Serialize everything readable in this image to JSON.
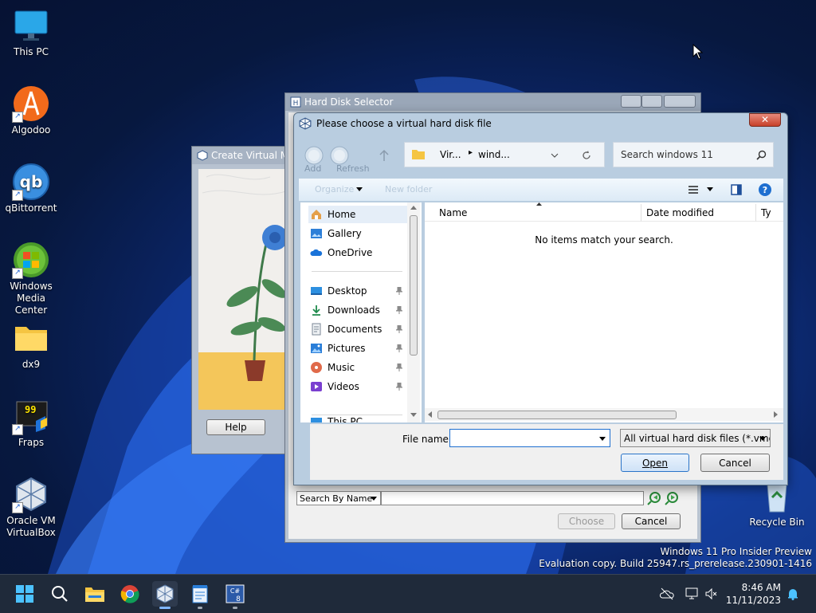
{
  "desktop": {
    "icons": [
      {
        "label": "This PC"
      },
      {
        "label": "Algodoo"
      },
      {
        "label": "qBittorrent"
      },
      {
        "label": "Windows Media Center"
      },
      {
        "label": "dx9"
      },
      {
        "label": "Fraps"
      },
      {
        "label": "Oracle VM VirtualBox"
      },
      {
        "label": "Recycle Bin"
      }
    ],
    "watermark_line1": "Windows 11 Pro Insider Preview",
    "watermark_line2": "Evaluation copy. Build 25947.rs_prerelease.230901-1416"
  },
  "create_vm": {
    "title": "Create Virtual M",
    "help_label": "Help"
  },
  "hd_selector": {
    "title": "Hard Disk Selector",
    "search_mode": "Search By Name",
    "choose_label": "Choose",
    "cancel_label": "Cancel"
  },
  "file_dialog": {
    "title": "Please choose a virtual hard disk file",
    "toolbar_add": "Add",
    "toolbar_refresh": "Refresh",
    "breadcrumb": [
      "Vir...",
      "wind..."
    ],
    "search_placeholder": "Search windows 11",
    "organize_label": "Organize",
    "new_folder_label": "New folder",
    "nav": {
      "home": "Home",
      "gallery": "Gallery",
      "onedrive": "OneDrive",
      "desktop": "Desktop",
      "downloads": "Downloads",
      "documents": "Documents",
      "pictures": "Pictures",
      "music": "Music",
      "videos": "Videos",
      "this_pc": "This PC"
    },
    "columns": {
      "name": "Name",
      "date_modified": "Date modified",
      "type": "Ty"
    },
    "empty_message": "No items match your search.",
    "file_name_label": "File name:",
    "file_name_value": "",
    "filter": "All virtual hard disk files (*.vmd",
    "open_label": "Open",
    "cancel_label": "Cancel"
  },
  "taskbar": {
    "time": "8:46 AM",
    "date": "11/11/2023"
  },
  "colors": {
    "classic_title": "#9aa7b8",
    "aero_frame": "#b9cde0",
    "accent_blue": "#1e6fd0",
    "taskbar": "#1f2a3a"
  }
}
